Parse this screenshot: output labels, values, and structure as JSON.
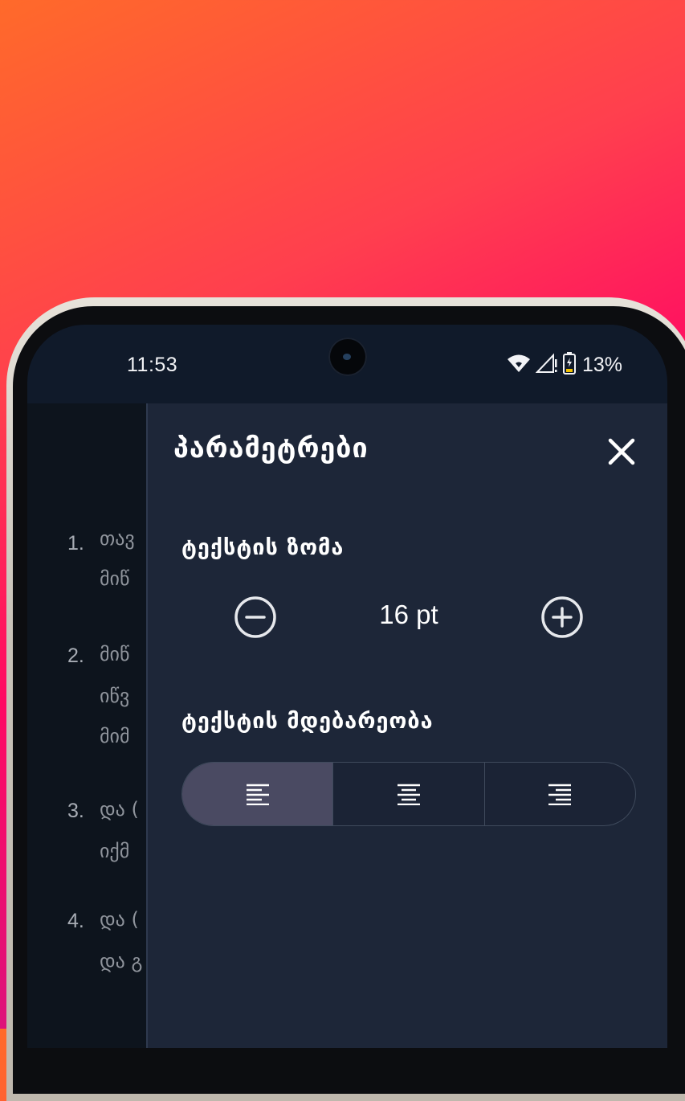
{
  "status_bar": {
    "time": "11:53",
    "battery_percent": "13%"
  },
  "background_list": [
    {
      "number": "1.",
      "lines": [
        "თავ",
        "მიწ"
      ]
    },
    {
      "number": "2.",
      "lines": [
        "მიწ",
        "იწვ",
        "მიმ"
      ]
    },
    {
      "number": "3.",
      "lines": [
        "და (",
        "იქმ"
      ]
    },
    {
      "number": "4.",
      "lines": [
        "და (",
        "და გ"
      ]
    }
  ],
  "settings_panel": {
    "title": "პარამეტრები",
    "text_size": {
      "label": "ტექსტის ზომა",
      "value": "16 pt"
    },
    "text_alignment": {
      "label": "ტექსტის მდებარეობა",
      "options": [
        "left",
        "center",
        "right"
      ],
      "selected": "left"
    }
  }
}
